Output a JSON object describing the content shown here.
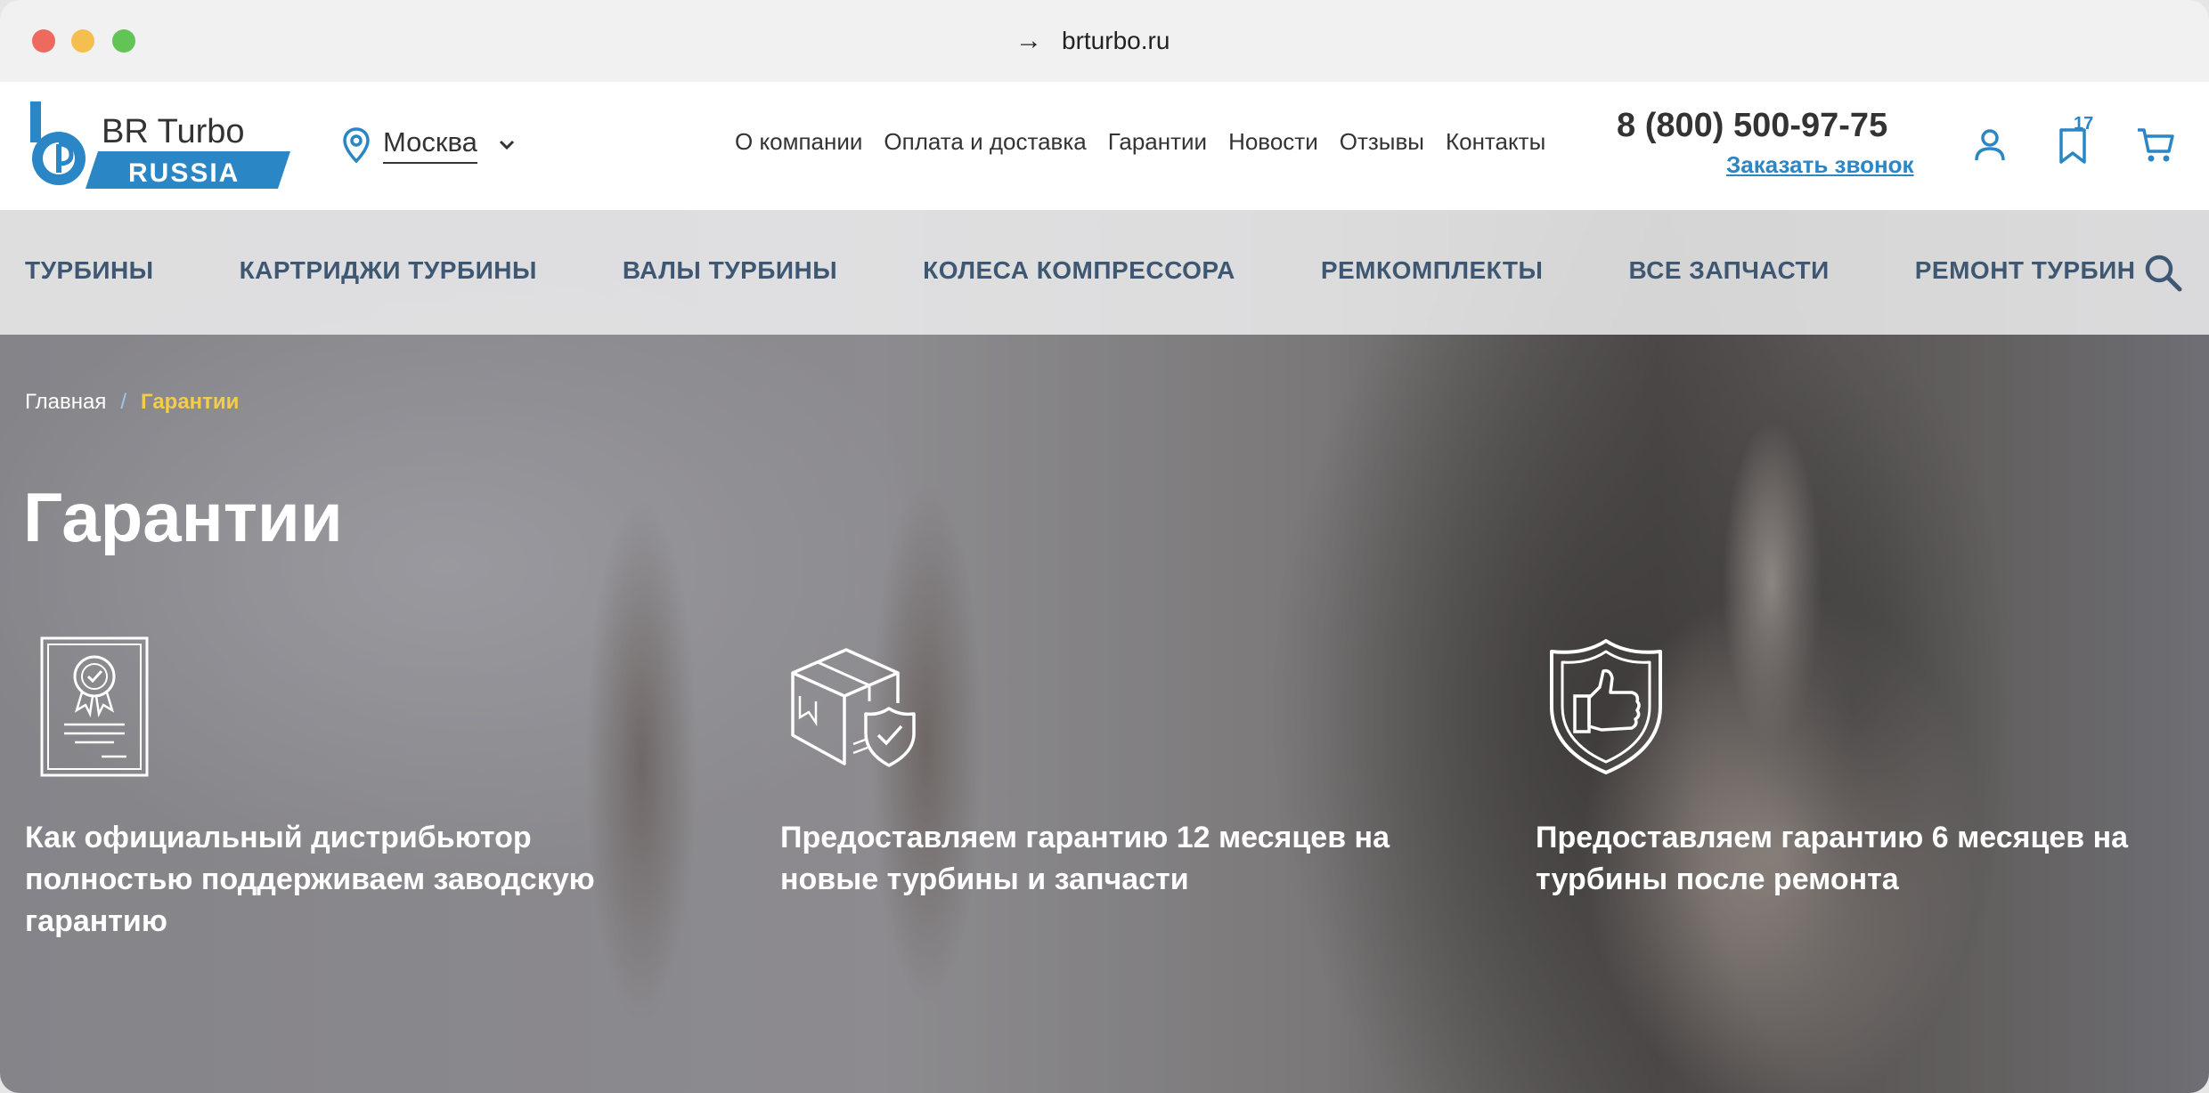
{
  "browser": {
    "url": "brturbo.ru",
    "nav_arrow": "→"
  },
  "header": {
    "logo": {
      "top_text": "BR Turbo",
      "bottom_text": "RUSSIA"
    },
    "city": "Москва",
    "nav": [
      "О компании",
      "Оплата и доставка",
      "Гарантии",
      "Новости",
      "Отзывы",
      "Контакты"
    ],
    "phone": "8 (800) 500-97-75",
    "callback": "Заказать звонок",
    "favorites_count": "17",
    "icons": [
      "user-icon",
      "bookmark-icon",
      "cart-icon"
    ]
  },
  "categories": [
    "ТУРБИНЫ",
    "КАРТРИДЖИ ТУРБИНЫ",
    "ВАЛЫ ТУРБИНЫ",
    "КОЛЕСА КОМПРЕССОРА",
    "РЕМКОМПЛЕКТЫ",
    "ВСЕ ЗАПЧАСТИ",
    "РЕМОНТ ТУРБИН"
  ],
  "breadcrumb": {
    "home": "Главная",
    "separator": "/",
    "current": "Гарантии"
  },
  "page_title": "Гарантии",
  "features": [
    {
      "icon": "certificate-icon",
      "text": "Как официальный дистрибьютор полностью поддерживаем заводскую гарантию"
    },
    {
      "icon": "box-shield-icon",
      "text": "Предоставляем гарантию 12 месяцев на новые турбины и запчасти"
    },
    {
      "icon": "thumbs-up-shield-icon",
      "text": "Предоставляем гарантию 6 месяцев на турбины после ремонта"
    }
  ],
  "colors": {
    "brand_blue": "#2b86c6",
    "category_text": "#3e5773",
    "breadcrumb_current": "#f4cc4c"
  }
}
